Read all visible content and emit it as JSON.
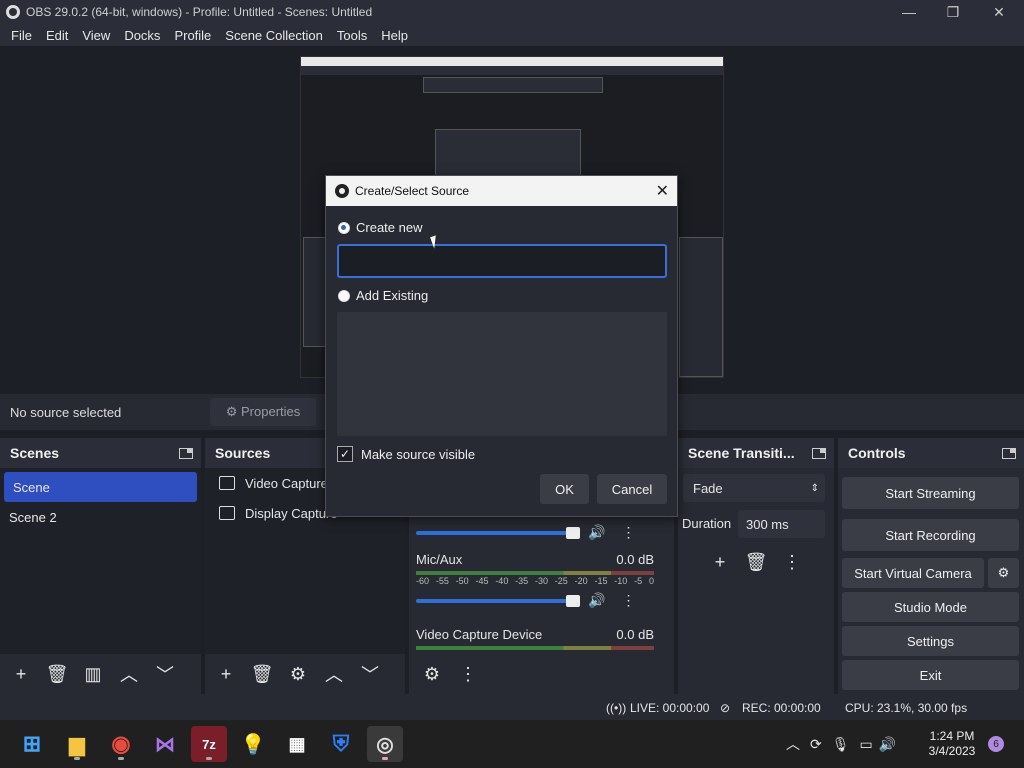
{
  "window": {
    "title": "OBS 29.0.2 (64-bit, windows) - Profile: Untitled - Scenes: Untitled",
    "minimize": "—",
    "maximize": "❐",
    "close": "✕"
  },
  "menu": [
    "File",
    "Edit",
    "View",
    "Docks",
    "Profile",
    "Scene Collection",
    "Tools",
    "Help"
  ],
  "source_bar": {
    "no_source": "No source selected",
    "properties": "⚙ Properties"
  },
  "scenes": {
    "title": "Scenes",
    "items": [
      "Scene",
      "Scene 2"
    ]
  },
  "sources": {
    "title": "Sources",
    "items": [
      "Video Capture",
      "Display Capture"
    ]
  },
  "mixer": {
    "channels": [
      {
        "name": "Mic/Aux",
        "db": "0.0 dB"
      },
      {
        "name": "Video Capture Device",
        "db": "0.0 dB"
      }
    ],
    "ticks": [
      "-60",
      "-55",
      "-50",
      "-45",
      "-40",
      "-35",
      "-30",
      "-25",
      "-20",
      "-15",
      "-10",
      "-5",
      "0"
    ]
  },
  "transitions": {
    "title": "Scene Transiti...",
    "selected": "Fade",
    "duration_label": "Duration",
    "duration_value": "300 ms"
  },
  "controls": {
    "title": "Controls",
    "buttons": [
      "Start Streaming",
      "Start Recording",
      "Start Virtual Camera",
      "Studio Mode",
      "Settings",
      "Exit"
    ]
  },
  "status": {
    "live": "LIVE: 00:00:00",
    "rec": "REC: 00:00:00",
    "cpu": "CPU: 23.1%, 30.00 fps"
  },
  "dialog": {
    "title": "Create/Select Source",
    "create_new": "Create new",
    "name_value": "",
    "add_existing": "Add Existing",
    "make_visible": "Make source visible",
    "ok": "OK",
    "cancel": "Cancel"
  },
  "taskbar": {
    "apps": [
      "start-icon",
      "file-explorer-icon",
      "chrome-icon",
      "visual-studio-icon",
      "7zip-icon",
      "lightbulb-icon",
      "store-icon",
      "defender-icon",
      "obs-icon"
    ],
    "time": "1:24 PM",
    "date": "3/4/2023",
    "notifications": "6"
  },
  "colors": {
    "accent": "#2f4ebf",
    "dialog_focus": "#3a6fd8",
    "background": "#1d1f26"
  }
}
